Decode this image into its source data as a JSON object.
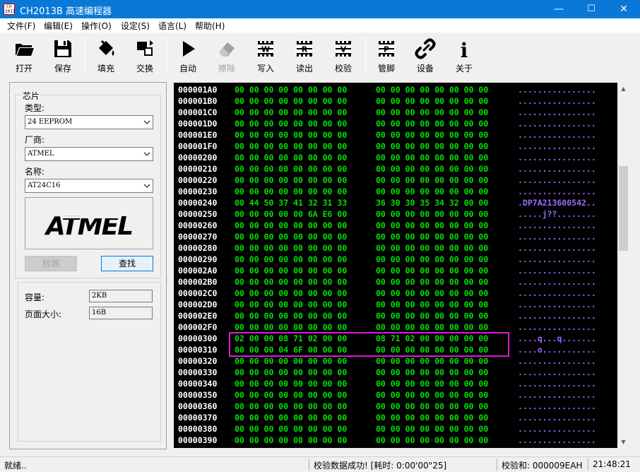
{
  "window": {
    "title": "CH2013B 高速编程器",
    "icon_text": [
      "CH",
      "2013"
    ],
    "minimize": "—",
    "maximize": "☐",
    "close": "✕"
  },
  "menu": [
    "文件(F)",
    "编辑(E)",
    "操作(O)",
    "设定(S)",
    "语言(L)",
    "帮助(H)"
  ],
  "toolbar": {
    "open": "打开",
    "save": "保存",
    "fill": "填充",
    "swap": "交换",
    "auto": "自动",
    "erase": "擦除",
    "write": "写入",
    "read": "读出",
    "verify": "校验",
    "pins": "管脚",
    "settings": "设备",
    "about": "关于",
    "write_chip_letter": "W",
    "read_chip_letter": "R",
    "verify_chip_letter": "V",
    "pins_chip_letter": "P",
    "about_glyph": "i"
  },
  "chip": {
    "group_label": "芯片",
    "type_label": "类型:",
    "type_value": "24 EEPROM",
    "vendor_label": "厂商:",
    "vendor_value": "ATMEL",
    "name_label": "名称:",
    "name_value": "AT24C16",
    "logo_text": "ATMEL",
    "detect_button": "检测",
    "find_button": "查找",
    "capacity_label": "容量:",
    "capacity_value": "2KB",
    "page_label": "页面大小:",
    "page_value": "16B"
  },
  "hex": {
    "rows": [
      {
        "addr": "000001A0",
        "b1": "00 00 00 00 00 00 00 00",
        "b2": "00 00 00 00 00 00 00 00",
        "asc": "................"
      },
      {
        "addr": "000001B0",
        "b1": "00 00 00 00 00 00 00 00",
        "b2": "00 00 00 00 00 00 00 00",
        "asc": "................"
      },
      {
        "addr": "000001C0",
        "b1": "00 00 00 00 00 00 00 00",
        "b2": "00 00 00 00 00 00 00 00",
        "asc": "................"
      },
      {
        "addr": "000001D0",
        "b1": "00 00 00 00 00 00 00 00",
        "b2": "00 00 00 00 00 00 00 00",
        "asc": "................"
      },
      {
        "addr": "000001E0",
        "b1": "00 00 00 00 00 00 00 00",
        "b2": "00 00 00 00 00 00 00 00",
        "asc": "................"
      },
      {
        "addr": "000001F0",
        "b1": "00 00 00 00 00 00 00 00",
        "b2": "00 00 00 00 00 00 00 00",
        "asc": "................"
      },
      {
        "addr": "00000200",
        "b1": "00 00 00 00 00 00 00 00",
        "b2": "00 00 00 00 00 00 00 00",
        "asc": "................"
      },
      {
        "addr": "00000210",
        "b1": "00 00 00 00 00 00 00 00",
        "b2": "00 00 00 00 00 00 00 00",
        "asc": "................"
      },
      {
        "addr": "00000220",
        "b1": "00 00 00 00 00 00 00 00",
        "b2": "00 00 00 00 00 00 00 00",
        "asc": "................"
      },
      {
        "addr": "00000230",
        "b1": "00 00 00 00 00 00 00 00",
        "b2": "00 00 00 00 00 00 00 00",
        "asc": "................"
      },
      {
        "addr": "00000240",
        "b1": "00 44 50 37 41 32 31 33",
        "b2": "36 30 30 35 34 32 00 00",
        "asc": ".DP7A213600542.."
      },
      {
        "addr": "00000250",
        "b1": "00 00 00 00 00 6A E6 00",
        "b2": "00 00 00 00 00 00 00 00",
        "asc": ".....j??........"
      },
      {
        "addr": "00000260",
        "b1": "00 00 00 00 00 00 00 00",
        "b2": "00 00 00 00 00 00 00 00",
        "asc": "................"
      },
      {
        "addr": "00000270",
        "b1": "00 00 00 00 00 00 00 00",
        "b2": "00 00 00 00 00 00 00 00",
        "asc": "................"
      },
      {
        "addr": "00000280",
        "b1": "00 00 00 00 00 00 00 00",
        "b2": "00 00 00 00 00 00 00 00",
        "asc": "................"
      },
      {
        "addr": "00000290",
        "b1": "00 00 00 00 00 00 00 00",
        "b2": "00 00 00 00 00 00 00 00",
        "asc": "................"
      },
      {
        "addr": "000002A0",
        "b1": "00 00 00 00 00 00 00 00",
        "b2": "00 00 00 00 00 00 00 00",
        "asc": "................"
      },
      {
        "addr": "000002B0",
        "b1": "00 00 00 00 00 00 00 00",
        "b2": "00 00 00 00 00 00 00 00",
        "asc": "................"
      },
      {
        "addr": "000002C0",
        "b1": "00 00 00 00 00 00 00 00",
        "b2": "00 00 00 00 00 00 00 00",
        "asc": "................"
      },
      {
        "addr": "000002D0",
        "b1": "00 00 00 00 00 00 00 00",
        "b2": "00 00 00 00 00 00 00 00",
        "asc": "................"
      },
      {
        "addr": "000002E0",
        "b1": "00 00 00 00 00 00 00 00",
        "b2": "00 00 00 00 00 00 00 00",
        "asc": "................"
      },
      {
        "addr": "000002F0",
        "b1": "00 00 00 00 00 00 00 00",
        "b2": "00 00 00 00 00 00 00 00",
        "asc": "................"
      },
      {
        "addr": "00000300",
        "b1": "02 00 00 08 71 02 00 00",
        "b2": "08 71 02 00 00 00 00 00",
        "asc": "....q...q......."
      },
      {
        "addr": "00000310",
        "b1": "00 00 00 04 6F 00 00 00",
        "b2": "00 00 00 00 00 00 00 00",
        "asc": "....o..........."
      },
      {
        "addr": "00000320",
        "b1": "00 00 00 00 00 00 00 00",
        "b2": "00 00 00 00 00 00 00 00",
        "asc": "................"
      },
      {
        "addr": "00000330",
        "b1": "00 00 00 00 00 00 00 00",
        "b2": "00 00 00 00 00 00 00 00",
        "asc": "................"
      },
      {
        "addr": "00000340",
        "b1": "00 00 00 00 00 00 00 00",
        "b2": "00 00 00 00 00 00 00 00",
        "asc": "................"
      },
      {
        "addr": "00000350",
        "b1": "00 00 00 00 00 00 00 00",
        "b2": "00 00 00 00 00 00 00 00",
        "asc": "................"
      },
      {
        "addr": "00000360",
        "b1": "00 00 00 00 00 00 00 00",
        "b2": "00 00 00 00 00 00 00 00",
        "asc": "................"
      },
      {
        "addr": "00000370",
        "b1": "00 00 00 00 00 00 00 00",
        "b2": "00 00 00 00 00 00 00 00",
        "asc": "................"
      },
      {
        "addr": "00000380",
        "b1": "00 00 00 00 00 00 00 00",
        "b2": "00 00 00 00 00 00 00 00",
        "asc": "................"
      },
      {
        "addr": "00000390",
        "b1": "00 00 00 00 00 00 00 00",
        "b2": "00 00 00 00 00 00 00 00",
        "asc": "................"
      }
    ]
  },
  "status": {
    "ready": "就绪..",
    "verify_message": "校验数据成功! [耗时: 0:00'00\"25]",
    "checksum": "校验和: 000009EAH",
    "time": "21:48:21"
  },
  "colors": {
    "titlebar": "#0a78d7",
    "hex_bg": "#000000",
    "addr": "#ffffff",
    "bytes": "#00e000",
    "ascii": "#9a6cff",
    "highlight": "#d81bd8"
  },
  "scrollbar": {
    "up_glyph": "▲",
    "down_glyph": "▼"
  }
}
